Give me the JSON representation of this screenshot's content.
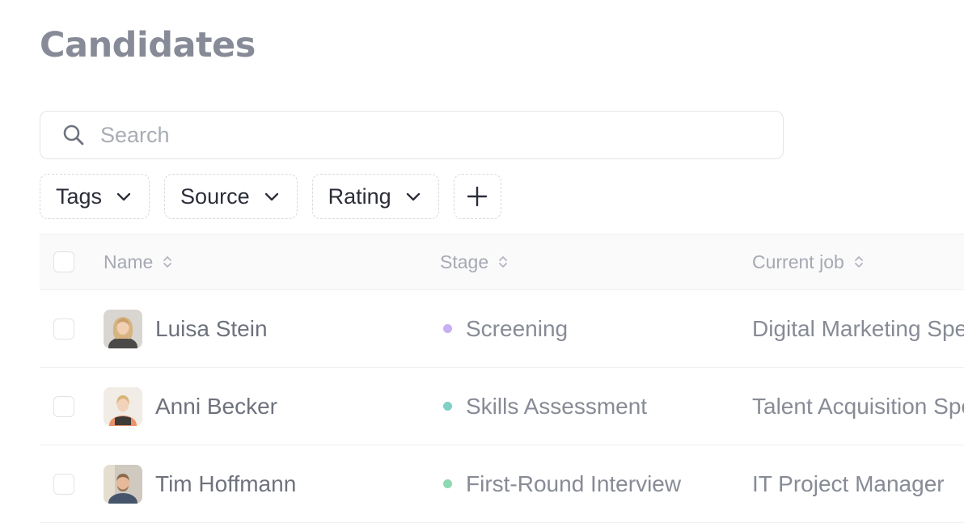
{
  "page": {
    "title": "Candidates"
  },
  "search": {
    "placeholder": "Search",
    "value": ""
  },
  "filters": [
    {
      "label": "Tags",
      "icon": "chevron-down-icon"
    },
    {
      "label": "Source",
      "icon": "chevron-down-icon"
    },
    {
      "label": "Rating",
      "icon": "chevron-down-icon"
    }
  ],
  "add_filter": {
    "icon": "plus-icon"
  },
  "table": {
    "columns": [
      {
        "label": "Name",
        "sortable": true
      },
      {
        "label": "Stage",
        "sortable": true
      },
      {
        "label": "Current job",
        "sortable": true
      }
    ],
    "rows": [
      {
        "name": "Luisa Stein",
        "stage": "Screening",
        "stage_color": "#c4b0f2",
        "current_job": "Digital Marketing Specialist",
        "avatar": "avatar-luisa-stein"
      },
      {
        "name": "Anni Becker",
        "stage": "Skills Assessment",
        "stage_color": "#7fd1c6",
        "current_job": "Talent Acquisition Specialist",
        "avatar": "avatar-anni-becker"
      },
      {
        "name": "Tim Hoffmann",
        "stage": "First-Round Interview",
        "stage_color": "#8fd8b4",
        "current_job": "IT Project Manager",
        "avatar": "avatar-tim-hoffmann"
      }
    ]
  },
  "colors": {
    "title": "#878b97",
    "border": "#e3e4e8",
    "header_bg": "#fafafb"
  }
}
